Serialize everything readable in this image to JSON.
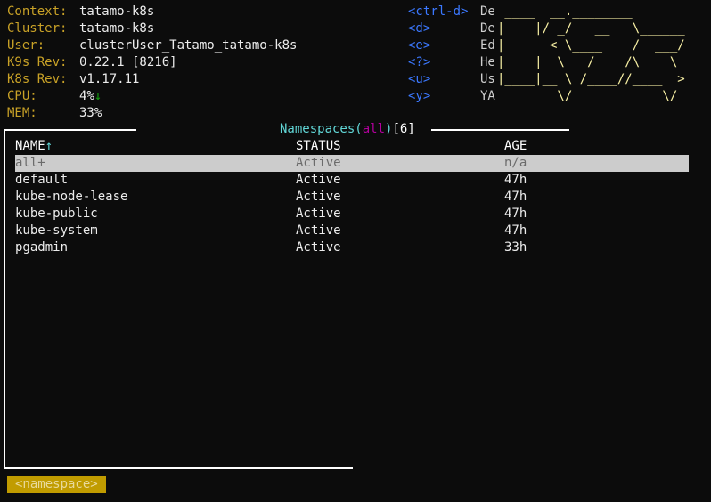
{
  "info": {
    "context": {
      "label": "Context:",
      "value": "tatamo-k8s"
    },
    "cluster": {
      "label": "Cluster:",
      "value": "tatamo-k8s"
    },
    "user": {
      "label": "User:",
      "value": "clusterUser_Tatamo_tatamo-k8s"
    },
    "k9s_rev": {
      "label": "K9s Rev:",
      "value": "0.22.1 [8216]"
    },
    "k8s_rev": {
      "label": "K8s Rev:",
      "value": "v1.17.11"
    },
    "cpu": {
      "label": "CPU:",
      "value": "4%",
      "trend": "↓"
    },
    "mem": {
      "label": "MEM:",
      "value": "33%"
    }
  },
  "hints": [
    {
      "key": "<ctrl-d>",
      "desc": "De"
    },
    {
      "key": "<d>",
      "desc": "De"
    },
    {
      "key": "<e>",
      "desc": "Ed"
    },
    {
      "key": "<?>",
      "desc": "He"
    },
    {
      "key": "<u>",
      "desc": "Us"
    },
    {
      "key": "<y>",
      "desc": "YA"
    }
  ],
  "logo": " ____  __.________\n|    |/ _/   __   \\______\n|      < \\____    /  ___/\n|    |  \\   /    /\\___ \\\n|____|__ \\ /____//____  >\n        \\/            \\/",
  "view": {
    "name": "Namespaces",
    "open_paren": "(",
    "namespace": "all",
    "close_paren": ")",
    "count": "[6]"
  },
  "table": {
    "headers": {
      "name": "NAME",
      "name_sort": "↑",
      "status": "STATUS",
      "age": "AGE"
    },
    "rows": [
      {
        "name": "all+",
        "status": "Active",
        "age": "n/a"
      },
      {
        "name": "default",
        "status": "Active",
        "age": "47h"
      },
      {
        "name": "kube-node-lease",
        "status": "Active",
        "age": "47h"
      },
      {
        "name": "kube-public",
        "status": "Active",
        "age": "47h"
      },
      {
        "name": "kube-system",
        "status": "Active",
        "age": "47h"
      },
      {
        "name": "pgadmin",
        "status": "Active",
        "age": "33h"
      }
    ]
  },
  "crumb": "<namespace>",
  "colors": {
    "background": "#0c0c0c",
    "label": "#c9a227",
    "key": "#3b78ff",
    "logo": "#f9f1a5",
    "title": "#61d6d6",
    "namespace": "#b4009e",
    "selection": "#cccccc",
    "crumb": "#c19c00"
  }
}
